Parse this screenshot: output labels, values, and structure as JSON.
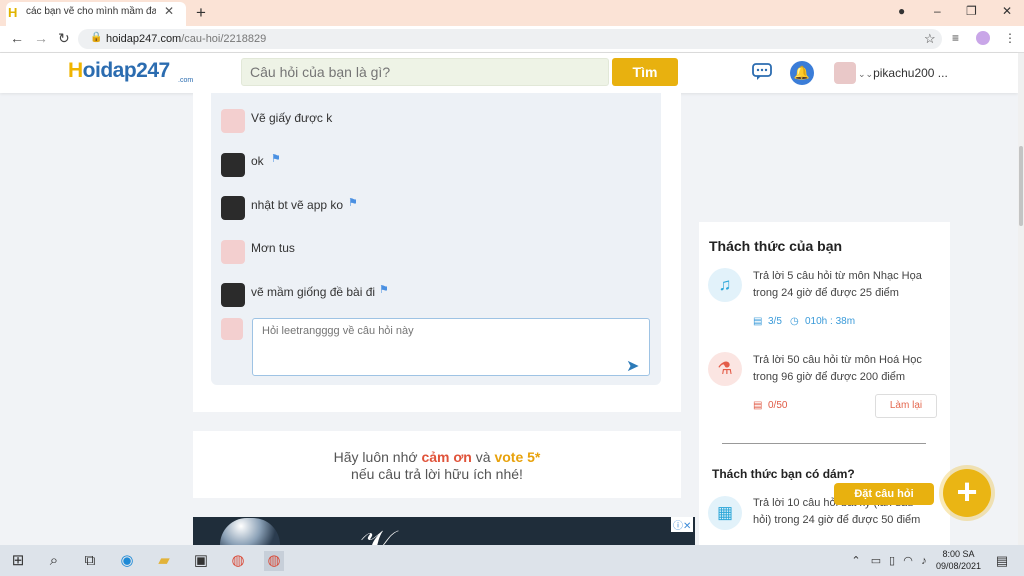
{
  "browser": {
    "tab_title": "các bạn vẽ cho mình mầm đang",
    "tab_favicon": "H",
    "url_host": "hoidap247.com",
    "url_path": "/cau-hoi/2218829"
  },
  "header": {
    "logo_main": "oidap247",
    "logo_h": "H",
    "logo_sub": ".com",
    "search_placeholder": "Câu hỏi của bạn là gì?",
    "search_button": "Tìm",
    "username": "pikachu200 ..."
  },
  "comments": [
    {
      "avatar": "pink",
      "text": "Vẽ giấy được k",
      "flag": false
    },
    {
      "avatar": "dark",
      "text": "ok",
      "flag": true
    },
    {
      "avatar": "dark",
      "text": "nhật bt vẽ app ko",
      "flag": true
    },
    {
      "avatar": "pink",
      "text": "Mơn tus",
      "flag": false
    },
    {
      "avatar": "dark",
      "text": "vẽ mầm giống đề bài đi",
      "flag": true
    }
  ],
  "reply": {
    "placeholder": "Hỏi leetrangggg về câu hỏi này"
  },
  "thanks": {
    "prefix": "Hãy luôn nhớ ",
    "cam_on": "cảm ơn",
    "mid": " và ",
    "vote": "vote 5*",
    "line2": "nếu câu trả lời hữu ích nhé!"
  },
  "sidebar": {
    "title": "Thách thức của bạn",
    "challenges": [
      {
        "icon": "music-note-icon",
        "text": "Trả lời 5 câu hỏi  từ môn Nhạc Họa trong 24 giờ để được 25 điểm",
        "progress": "3/5",
        "time": "010h : 38m"
      },
      {
        "icon": "chemistry-icon",
        "text": "Trả lời 50 câu hỏi  từ môn Hoá Học trong 96 giờ để được 200 điểm",
        "progress": "0/50",
        "retry": "Làm lại"
      }
    ],
    "sub_title": "Thách thức bạn có dám?",
    "dare": {
      "text": "Trả lời 10 câu hỏi bất kỳ (lần đầu hỏi) trong 24 giờ để được 50 điểm"
    }
  },
  "fab": {
    "label": "Đặt câu hỏi"
  },
  "taskbar": {
    "time": "8:00 SA",
    "date": "09/08/2021"
  }
}
